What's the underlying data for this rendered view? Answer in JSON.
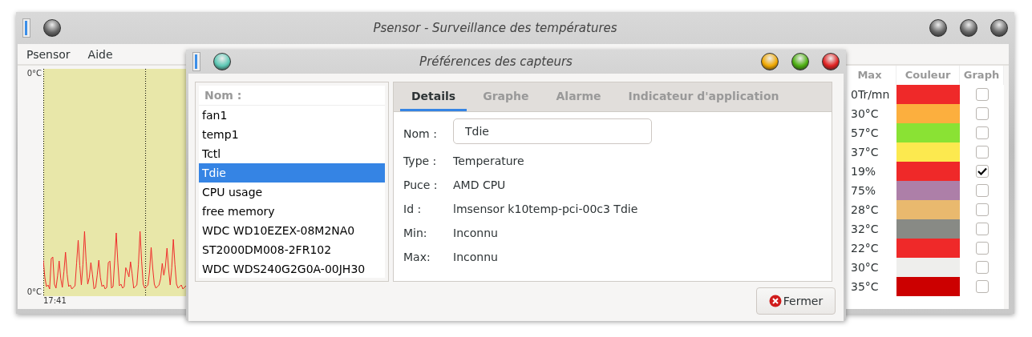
{
  "main_window": {
    "title": "Psensor - Surveillance des températures",
    "menu": [
      "Psensor",
      "Aide"
    ],
    "graph": {
      "y_top": "0°C",
      "y_bottom": "0°C",
      "x_start": "17:41"
    },
    "table": {
      "columns": [
        "Max",
        "Couleur",
        "Graph"
      ],
      "rows": [
        {
          "max": "0Tr/mn",
          "color": "#ef2929",
          "graph": false
        },
        {
          "max": "30°C",
          "color": "#fcaf3e",
          "graph": false
        },
        {
          "max": "57°C",
          "color": "#8ae234",
          "graph": false
        },
        {
          "max": "37°C",
          "color": "#fce94f",
          "graph": false
        },
        {
          "max": "19%",
          "color": "#ef2929",
          "graph": true
        },
        {
          "max": "75%",
          "color": "#ad7fa8",
          "graph": false
        },
        {
          "max": "28°C",
          "color": "#e9b96e",
          "graph": false
        },
        {
          "max": "32°C",
          "color": "#888a85",
          "graph": false
        },
        {
          "max": "22°C",
          "color": "#ef2929",
          "graph": false
        },
        {
          "max": "30°C",
          "color": "#eeeeec",
          "graph": false
        },
        {
          "max": "35°C",
          "color": "#cc0000",
          "graph": false
        }
      ]
    }
  },
  "dialog": {
    "title": "Préférences des capteurs",
    "sensor_list": {
      "header": "Nom :",
      "items": [
        {
          "label": "fan1",
          "selected": false
        },
        {
          "label": "temp1",
          "selected": false
        },
        {
          "label": "Tctl",
          "selected": false
        },
        {
          "label": "Tdie",
          "selected": true
        },
        {
          "label": "CPU usage",
          "selected": false
        },
        {
          "label": "free memory",
          "selected": false
        },
        {
          "label": "WDC WD10EZEX-08M2NA0",
          "selected": false
        },
        {
          "label": "ST2000DM008-2FR102",
          "selected": false
        },
        {
          "label": "WDC WDS240G2G0A-00JH30",
          "selected": false
        }
      ]
    },
    "tabs": [
      {
        "label": "Details",
        "selected": true
      },
      {
        "label": "Graphe",
        "selected": false
      },
      {
        "label": "Alarme",
        "selected": false
      },
      {
        "label": "Indicateur d'application",
        "selected": false
      }
    ],
    "name_field": {
      "label": "Nom :",
      "value": "Tdie"
    },
    "fields": [
      {
        "label": "Type :",
        "value": "Temperature"
      },
      {
        "label": "Puce :",
        "value": "AMD CPU"
      },
      {
        "label": "Id :",
        "value": "lmsensor k10temp-pci-00c3 Tdie"
      },
      {
        "label": "Min:",
        "value": "Inconnu"
      },
      {
        "label": "Max:",
        "value": "Inconnu"
      }
    ],
    "close_button": "Fermer"
  }
}
